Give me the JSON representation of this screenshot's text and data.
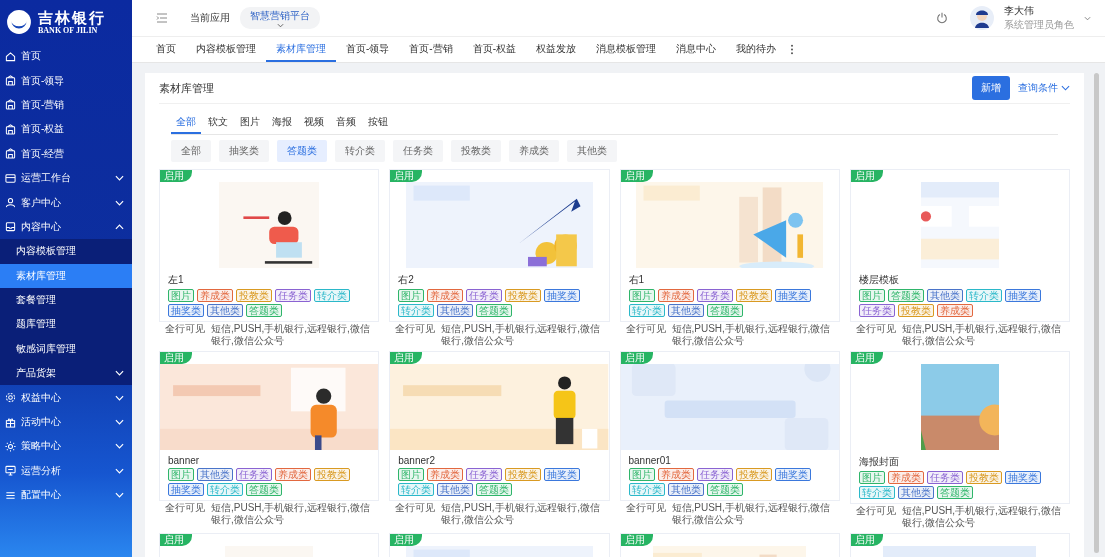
{
  "sidebar": {
    "logo": {
      "name": "吉林银行",
      "subtitle": "BANK OF JILIN"
    },
    "items": [
      {
        "label": "首页",
        "selected": false
      },
      {
        "label": "首页-领导",
        "selected": false
      },
      {
        "label": "首页-营销",
        "selected": false
      },
      {
        "label": "首页-权益",
        "selected": false
      },
      {
        "label": "首页-经营",
        "selected": false
      },
      {
        "label": "运营工作台",
        "selected": false,
        "expanded": false
      },
      {
        "label": "客户中心",
        "selected": false,
        "expanded": false
      },
      {
        "label": "内容中心",
        "selected": false,
        "expanded": true,
        "children": [
          {
            "label": "内容模板管理",
            "selected": false
          },
          {
            "label": "素材库管理",
            "selected": true
          },
          {
            "label": "套餐管理",
            "selected": false
          },
          {
            "label": "题库管理",
            "selected": false
          },
          {
            "label": "敏感词库管理",
            "selected": false
          },
          {
            "label": "产品货架",
            "selected": false,
            "expanded": false
          }
        ]
      },
      {
        "label": "权益中心",
        "selected": false,
        "expanded": false
      },
      {
        "label": "活动中心",
        "selected": false,
        "expanded": false
      },
      {
        "label": "策略中心",
        "selected": false,
        "expanded": false
      },
      {
        "label": "运营分析",
        "selected": false,
        "expanded": false
      },
      {
        "label": "配置中心",
        "selected": false,
        "expanded": false
      }
    ]
  },
  "header": {
    "app_label": "当前应用",
    "app_select": "智慧营销平台",
    "user": {
      "name": "李大伟",
      "role": "系统管理员角色"
    }
  },
  "tabs": [
    {
      "label": "首页",
      "selected": false
    },
    {
      "label": "内容模板管理",
      "selected": false
    },
    {
      "label": "素材库管理",
      "selected": true
    },
    {
      "label": "首页-领导",
      "selected": false
    },
    {
      "label": "首页-营销",
      "selected": false
    },
    {
      "label": "首页-权益",
      "selected": false
    },
    {
      "label": "权益发放",
      "selected": false
    },
    {
      "label": "消息模板管理",
      "selected": false
    },
    {
      "label": "消息中心",
      "selected": false
    },
    {
      "label": "我的待办",
      "selected": false
    }
  ],
  "panel": {
    "title": "素材库管理",
    "add_button": "新增",
    "filter_toggle": "查询条件",
    "type_tabs": [
      {
        "label": "全部",
        "selected": true
      },
      {
        "label": "软文",
        "selected": false
      },
      {
        "label": "图片",
        "selected": false
      },
      {
        "label": "海报",
        "selected": false
      },
      {
        "label": "视频",
        "selected": false
      },
      {
        "label": "音频",
        "selected": false
      },
      {
        "label": "按钮",
        "selected": false
      }
    ],
    "categories": [
      {
        "label": "全部",
        "selected": false
      },
      {
        "label": "抽奖类",
        "selected": false
      },
      {
        "label": "答题类",
        "selected": true
      },
      {
        "label": "转介类",
        "selected": false
      },
      {
        "label": "任务类",
        "selected": false
      },
      {
        "label": "投教类",
        "selected": false
      },
      {
        "label": "养成类",
        "selected": false
      },
      {
        "label": "其他类",
        "selected": false
      }
    ],
    "cards": [
      {
        "status": "启用",
        "title": "左1",
        "tags": [
          {
            "label": "图片",
            "color": "#2fb56a"
          },
          {
            "label": "养成类",
            "color": "#e2683f"
          },
          {
            "label": "投教类",
            "color": "#d99a22"
          },
          {
            "label": "任务类",
            "color": "#8a63d2"
          },
          {
            "label": "转介类",
            "color": "#2bb8c9"
          },
          {
            "label": "抽奖类",
            "color": "#3b78dc"
          },
          {
            "label": "其他类",
            "color": "#4a74c9"
          },
          {
            "label": "答题类",
            "color": "#2fb56a"
          }
        ],
        "visibility": "全行可见",
        "channels": "短信,PUSH,手机银行,远程银行,微信银行,微信公众号"
      },
      {
        "status": "启用",
        "title": "右2",
        "tags": [
          {
            "label": "图片",
            "color": "#2fb56a"
          },
          {
            "label": "养成类",
            "color": "#e2683f"
          },
          {
            "label": "任务类",
            "color": "#8a63d2"
          },
          {
            "label": "投教类",
            "color": "#d99a22"
          },
          {
            "label": "抽奖类",
            "color": "#3b78dc"
          },
          {
            "label": "转介类",
            "color": "#2bb8c9"
          },
          {
            "label": "其他类",
            "color": "#4a74c9"
          },
          {
            "label": "答题类",
            "color": "#2fb56a"
          }
        ],
        "visibility": "全行可见",
        "channels": "短信,PUSH,手机银行,远程银行,微信银行,微信公众号"
      },
      {
        "status": "启用",
        "title": "右1",
        "tags": [
          {
            "label": "图片",
            "color": "#2fb56a"
          },
          {
            "label": "养成类",
            "color": "#e2683f"
          },
          {
            "label": "任务类",
            "color": "#8a63d2"
          },
          {
            "label": "投教类",
            "color": "#d99a22"
          },
          {
            "label": "抽奖类",
            "color": "#3b78dc"
          },
          {
            "label": "转介类",
            "color": "#2bb8c9"
          },
          {
            "label": "其他类",
            "color": "#4a74c9"
          },
          {
            "label": "答题类",
            "color": "#2fb56a"
          }
        ],
        "visibility": "全行可见",
        "channels": "短信,PUSH,手机银行,远程银行,微信银行,微信公众号"
      },
      {
        "status": "启用",
        "title": "楼层模板",
        "tags": [
          {
            "label": "图片",
            "color": "#2fb56a"
          },
          {
            "label": "答题类",
            "color": "#2fb56a"
          },
          {
            "label": "其他类",
            "color": "#4a74c9"
          },
          {
            "label": "转介类",
            "color": "#2bb8c9"
          },
          {
            "label": "抽奖类",
            "color": "#3b78dc"
          },
          {
            "label": "任务类",
            "color": "#8a63d2"
          },
          {
            "label": "投教类",
            "color": "#d99a22"
          },
          {
            "label": "养成类",
            "color": "#e2683f"
          }
        ],
        "visibility": "全行可见",
        "channels": "短信,PUSH,手机银行,远程银行,微信银行,微信公众号"
      },
      {
        "status": "启用",
        "title": "banner",
        "tags": [
          {
            "label": "图片",
            "color": "#2fb56a"
          },
          {
            "label": "其他类",
            "color": "#4a74c9"
          },
          {
            "label": "任务类",
            "color": "#8a63d2"
          },
          {
            "label": "养成类",
            "color": "#e2683f"
          },
          {
            "label": "投教类",
            "color": "#d99a22"
          },
          {
            "label": "抽奖类",
            "color": "#3b78dc"
          },
          {
            "label": "转介类",
            "color": "#2bb8c9"
          },
          {
            "label": "答题类",
            "color": "#2fb56a"
          }
        ],
        "visibility": "全行可见",
        "channels": "短信,PUSH,手机银行,远程银行,微信银行,微信公众号"
      },
      {
        "status": "启用",
        "title": "banner2",
        "tags": [
          {
            "label": "图片",
            "color": "#2fb56a"
          },
          {
            "label": "养成类",
            "color": "#e2683f"
          },
          {
            "label": "任务类",
            "color": "#8a63d2"
          },
          {
            "label": "投教类",
            "color": "#d99a22"
          },
          {
            "label": "抽奖类",
            "color": "#3b78dc"
          },
          {
            "label": "转介类",
            "color": "#2bb8c9"
          },
          {
            "label": "其他类",
            "color": "#4a74c9"
          },
          {
            "label": "答题类",
            "color": "#2fb56a"
          }
        ],
        "visibility": "全行可见",
        "channels": "短信,PUSH,手机银行,远程银行,微信银行,微信公众号"
      },
      {
        "status": "启用",
        "title": "banner01",
        "tags": [
          {
            "label": "图片",
            "color": "#2fb56a"
          },
          {
            "label": "养成类",
            "color": "#e2683f"
          },
          {
            "label": "任务类",
            "color": "#8a63d2"
          },
          {
            "label": "投教类",
            "color": "#d99a22"
          },
          {
            "label": "抽奖类",
            "color": "#3b78dc"
          },
          {
            "label": "转介类",
            "color": "#2bb8c9"
          },
          {
            "label": "其他类",
            "color": "#4a74c9"
          },
          {
            "label": "答题类",
            "color": "#2fb56a"
          }
        ],
        "visibility": "全行可见",
        "channels": "短信,PUSH,手机银行,远程银行,微信银行,微信公众号"
      },
      {
        "status": "启用",
        "title": "海报封面",
        "tags": [
          {
            "label": "图片",
            "color": "#2fb56a"
          },
          {
            "label": "养成类",
            "color": "#e2683f"
          },
          {
            "label": "任务类",
            "color": "#8a63d2"
          },
          {
            "label": "投教类",
            "color": "#d99a22"
          },
          {
            "label": "抽奖类",
            "color": "#3b78dc"
          },
          {
            "label": "转介类",
            "color": "#2bb8c9"
          },
          {
            "label": "其他类",
            "color": "#4a74c9"
          },
          {
            "label": "答题类",
            "color": "#2fb56a"
          }
        ],
        "visibility": "全行可见",
        "channels": "短信,PUSH,手机银行,远程银行,微信银行,微信公众号"
      },
      {
        "status": "启用"
      },
      {
        "status": "启用"
      },
      {
        "status": "启用"
      },
      {
        "status": "启用"
      }
    ]
  }
}
